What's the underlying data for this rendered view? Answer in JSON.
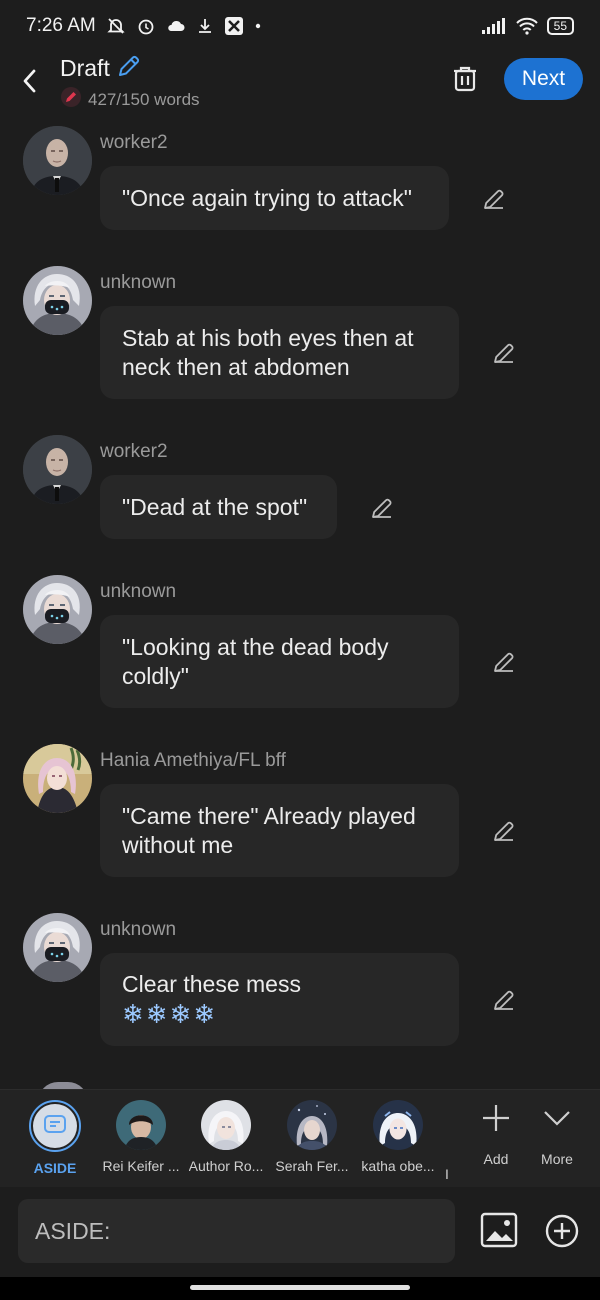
{
  "status_bar": {
    "time": "7:26 AM",
    "battery": "55",
    "icons": [
      "silent-bell-icon",
      "alarm-icon",
      "cloud-icon",
      "download-icon",
      "app-icon",
      "dot-icon",
      "signal-icon",
      "wifi-icon",
      "battery-icon"
    ]
  },
  "header": {
    "title": "Draft",
    "word_count": "427/150 words",
    "next_label": "Next",
    "icons": [
      "back-arrow-icon",
      "pencil-icon",
      "red-pen-icon",
      "trash-icon"
    ]
  },
  "messages": [
    {
      "sender": "worker2",
      "lines": [
        "\"Once again trying to attack\""
      ],
      "avatar": "bald-man"
    },
    {
      "sender": "unknown",
      "lines": [
        "Stab at his both eyes then at",
        "neck then at abdomen"
      ],
      "avatar": "masked-white-hair"
    },
    {
      "sender": "worker2",
      "lines": [
        "\"Dead at the spot\""
      ],
      "avatar": "bald-man"
    },
    {
      "sender": "unknown",
      "lines": [
        "\"Looking at the dead body",
        "coldly\""
      ],
      "avatar": "masked-white-hair"
    },
    {
      "sender": "Hania Amethiya/FL bff",
      "lines": [
        "\"Came there\" Already played",
        "without me"
      ],
      "avatar": "pink-hair-girl"
    },
    {
      "sender": "unknown",
      "lines": [
        "Clear these mess",
        "❄❄❄❄"
      ],
      "avatar": "masked-white-hair"
    }
  ],
  "characters": [
    {
      "name": "ASIDE"
    },
    {
      "name": "Rei Keifer ..."
    },
    {
      "name": "Author Ro..."
    },
    {
      "name": "Serah Fer..."
    },
    {
      "name": "katha obe..."
    },
    {
      "name": "I"
    }
  ],
  "tools": {
    "add_label": "Add",
    "more_label": "More"
  },
  "input": {
    "placeholder": "ASIDE:"
  },
  "colors": {
    "background": "#1d1d1d",
    "bubble": "#272727",
    "accent": "#1d72d2",
    "aside_accent": "#5aa2ef"
  }
}
